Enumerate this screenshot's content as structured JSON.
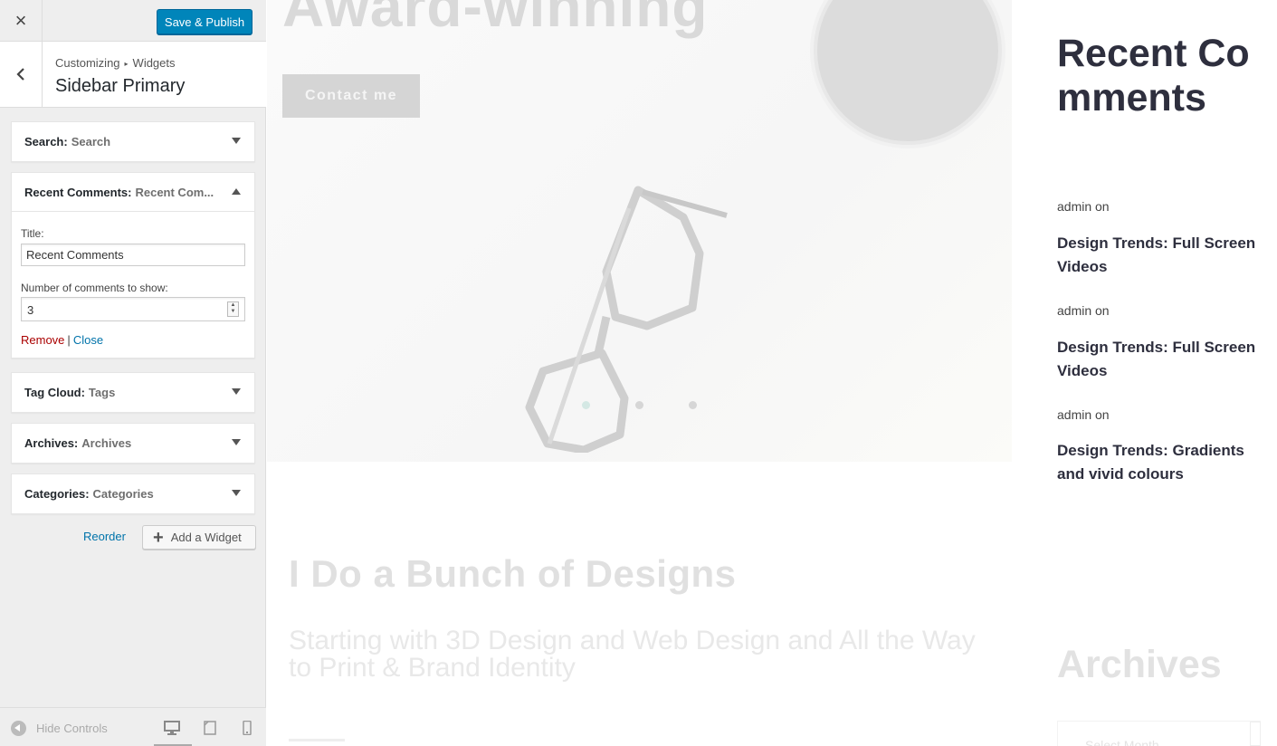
{
  "customizer": {
    "close_glyph": "×",
    "publish_label": "Save & Publish",
    "breadcrumb": {
      "root": "Customizing",
      "separator": "▸",
      "section": "Widgets"
    },
    "panel_title": "Sidebar Primary",
    "widgets": [
      {
        "name": "Search:",
        "title": "Search",
        "expanded": false
      },
      {
        "name": "Recent Comments:",
        "title": "Recent Com...",
        "expanded": true
      },
      {
        "name": "Tag Cloud:",
        "title": "Tags",
        "expanded": false
      },
      {
        "name": "Archives:",
        "title": "Archives",
        "expanded": false
      },
      {
        "name": "Categories:",
        "title": "Categories",
        "expanded": false
      }
    ],
    "recent_form": {
      "title_label": "Title:",
      "title_value": "Recent Comments",
      "number_label": "Number of comments to show:",
      "number_value": "3",
      "remove_label": "Remove",
      "pipe": "|",
      "close_label": "Close"
    },
    "reorder_label": "Reorder",
    "add_widget_label": "Add a Widget",
    "add_widget_glyph": "+",
    "footer": {
      "hide_controls_label": "Hide Controls",
      "active_device": "desktop"
    }
  },
  "preview": {
    "hero_heading": "Award-winning",
    "contact_label": "Contact me",
    "slider_dots": [
      {
        "active": true
      },
      {
        "active": false
      },
      {
        "active": false
      }
    ],
    "designs_heading": "I Do a Bunch of Designs",
    "designs_sub": "Starting with 3D Design and Web Design and All the Way to Print & Brand Identity",
    "sidebar": {
      "recent_title": "Recent Comments",
      "comments": [
        {
          "meta": "admin on",
          "link": "Design Trends: Full Screen Videos"
        },
        {
          "meta": "admin on",
          "link": "Design Trends: Full Screen Videos"
        },
        {
          "meta": "admin on",
          "link": "Design Trends: Gradients and vivid colours"
        }
      ],
      "archives_title": "Archives",
      "archive_select_value": "Select Month"
    }
  }
}
